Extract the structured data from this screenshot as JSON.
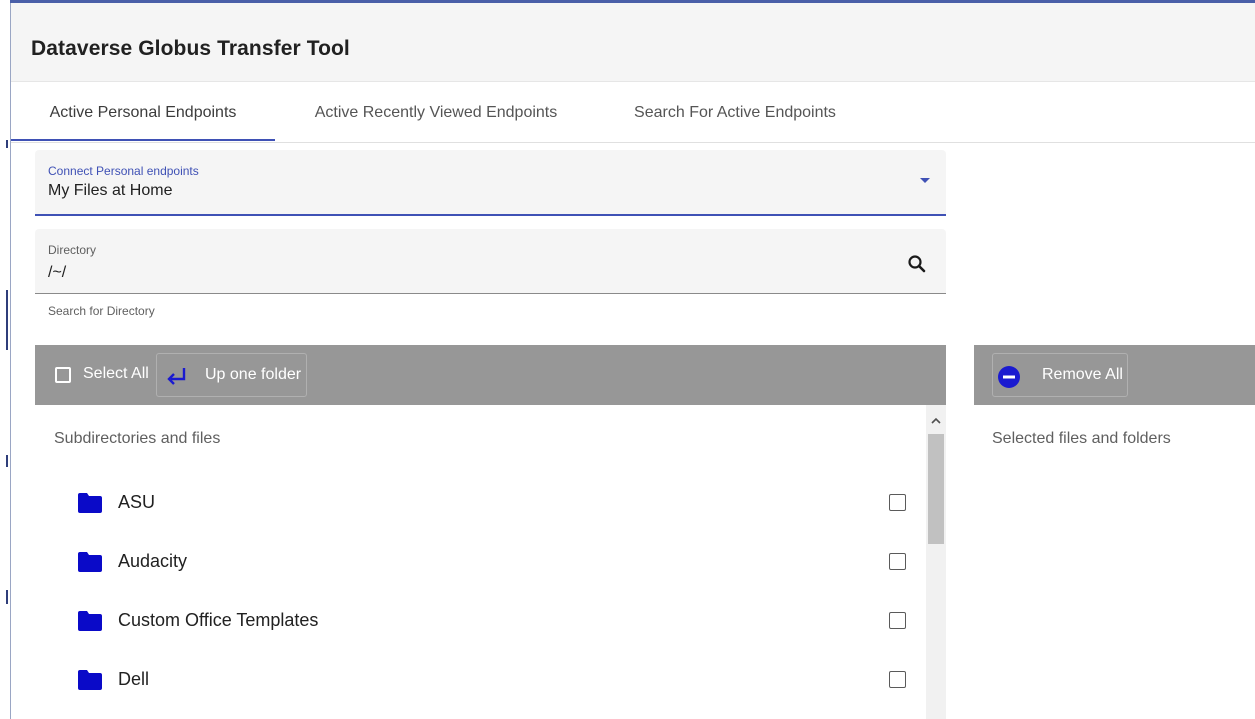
{
  "app": {
    "title": "Dataverse Globus Transfer Tool"
  },
  "tabs": [
    {
      "label": "Active Personal Endpoints",
      "active": true
    },
    {
      "label": "Active Recently Viewed Endpoints",
      "active": false
    },
    {
      "label": "Search For Active Endpoints",
      "active": false
    }
  ],
  "endpoint_select": {
    "label": "Connect Personal endpoints",
    "value": "My Files at Home"
  },
  "directory": {
    "label": "Directory",
    "value": "/~/",
    "hint": "Search for Directory"
  },
  "file_toolbar": {
    "select_all_label": "Select All",
    "select_all_checked": false,
    "up_folder_label": "Up one folder"
  },
  "file_list": {
    "heading": "Subdirectories and files",
    "items": [
      {
        "name": "ASU",
        "type": "folder",
        "checked": false
      },
      {
        "name": "Audacity",
        "type": "folder",
        "checked": false
      },
      {
        "name": "Custom Office Templates",
        "type": "folder",
        "checked": false
      },
      {
        "name": "Dell",
        "type": "folder",
        "checked": false
      }
    ]
  },
  "selected_panel": {
    "remove_all_label": "Remove All",
    "heading": "Selected files and folders"
  },
  "colors": {
    "accent": "#3f51b5",
    "folder": "#0a0ac8",
    "toolbar": "#979797",
    "header_bg": "#f5f5f5",
    "field_bg": "#f5f5f5"
  },
  "icons": {
    "search": "search-icon",
    "dropdown": "dropdown-arrow-icon",
    "up_folder": "return-arrow-icon",
    "folder": "folder-icon",
    "remove": "minus-circle-icon",
    "scroll_up": "chevron-up-icon"
  }
}
